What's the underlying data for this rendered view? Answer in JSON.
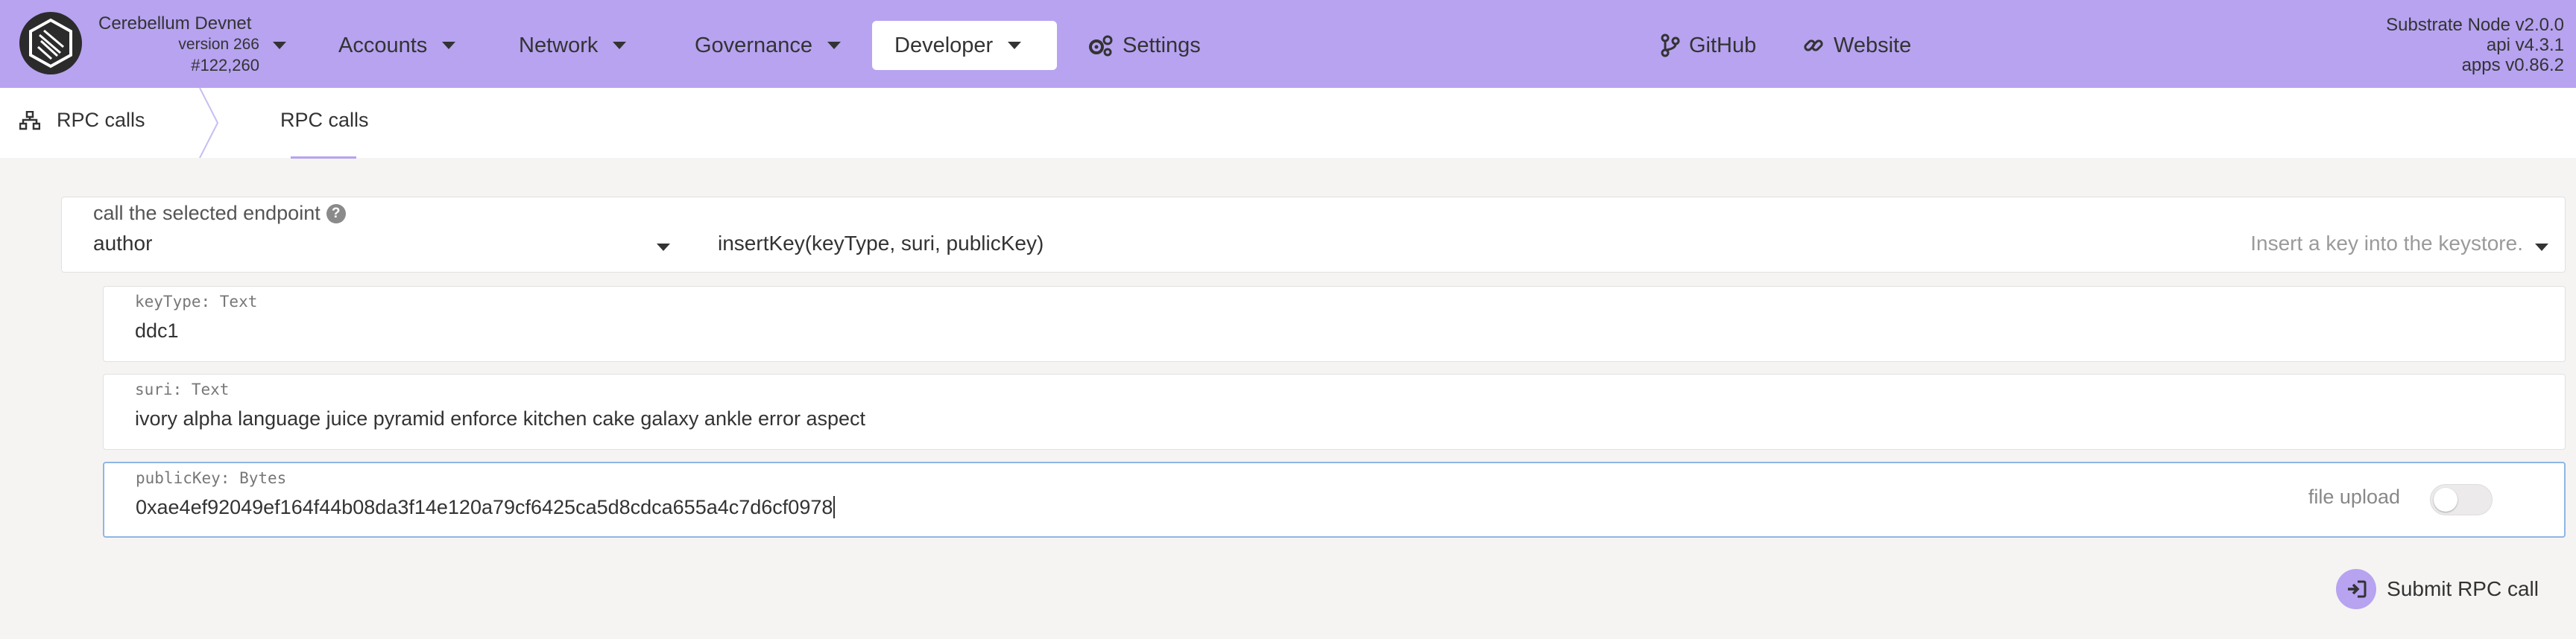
{
  "chain": {
    "name": "Cerebellum Devnet",
    "version": "version 266",
    "block": "#122,260"
  },
  "nav": {
    "accounts": "Accounts",
    "network": "Network",
    "governance": "Governance",
    "developer": "Developer",
    "settings": "Settings",
    "github": "GitHub",
    "website": "Website"
  },
  "node": {
    "name": "Substrate Node v2.0.0",
    "api": "api v4.3.1",
    "apps": "apps v0.86.2"
  },
  "subnav": {
    "section": "RPC calls",
    "tab": "RPC calls"
  },
  "endpoint": {
    "label": "call the selected endpoint",
    "section": "author",
    "method": "insertKey(keyType, suri, publicKey)",
    "description": "Insert a key into the keystore."
  },
  "params": [
    {
      "label": "keyType: Text",
      "value": "ddc1"
    },
    {
      "label": "suri: Text",
      "value": "ivory alpha language juice pyramid enforce kitchen cake galaxy ankle error aspect"
    },
    {
      "label": "publicKey: Bytes",
      "value": "0xae4ef92049ef164f44b08da3f14e120a79cf6425ca5d8cdca655a4c7d6cf0978"
    }
  ],
  "file_upload": {
    "label": "file upload",
    "enabled": false
  },
  "submit_label": "Submit RPC call",
  "colors": {
    "accent": "#b7a3f0",
    "background": "#f5f4f3",
    "focus_border": "#8fb6e4"
  }
}
